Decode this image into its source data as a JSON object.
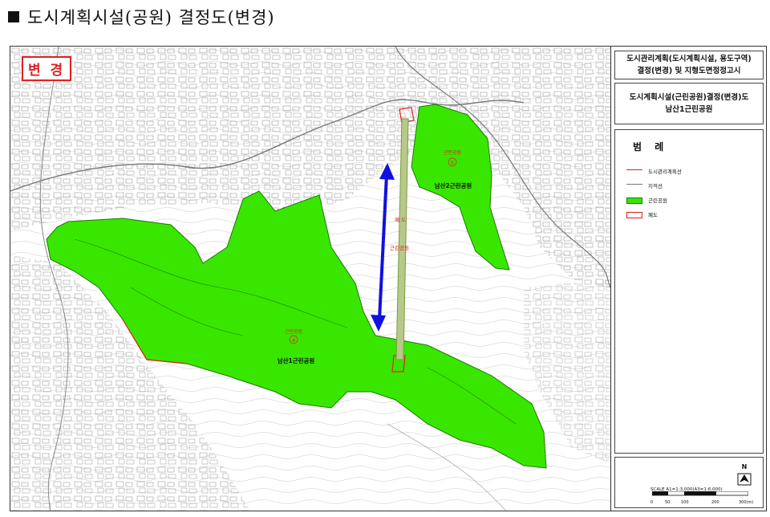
{
  "document": {
    "title": "도시계획시설(공원) 결정도(변경)"
  },
  "map": {
    "change_badge": "변 경",
    "park_labels": [
      {
        "name": "남산2근린공원",
        "tag": "근린공원",
        "number": "5"
      },
      {
        "name": "남산1근린공원",
        "tag": "근린공원",
        "number": "4"
      }
    ],
    "corridor_labels": [
      "폐 도",
      "근린공원"
    ],
    "colors": {
      "park_fill": "#39e600",
      "boundary": "#e0201c",
      "arrow": "#1010e0",
      "corridor": "#7a9a3a"
    }
  },
  "legend_panel": {
    "notice_lines": [
      "도시관리계획(도시계획시설, 용도구역)",
      "결정(변경) 및 지형도면정정고시"
    ],
    "plan_lines": [
      "도시계획시설(근린공원)결정(변경)도",
      "남산1근린공원"
    ],
    "legend": {
      "title": "범 례",
      "items": [
        {
          "label": "도시관리계획선",
          "symbol": "red-line"
        },
        {
          "label": "지적선",
          "symbol": "gray-line"
        },
        {
          "label": "근린공원",
          "symbol": "green-fill"
        },
        {
          "label": "폐도",
          "symbol": "hatched-box"
        }
      ]
    },
    "north_label": "N",
    "scale_text": "SCALE A1=1:3,000(A3=1:6,000)",
    "scale_ticks": [
      "0",
      "50",
      "100",
      "200",
      "300(m)"
    ]
  }
}
